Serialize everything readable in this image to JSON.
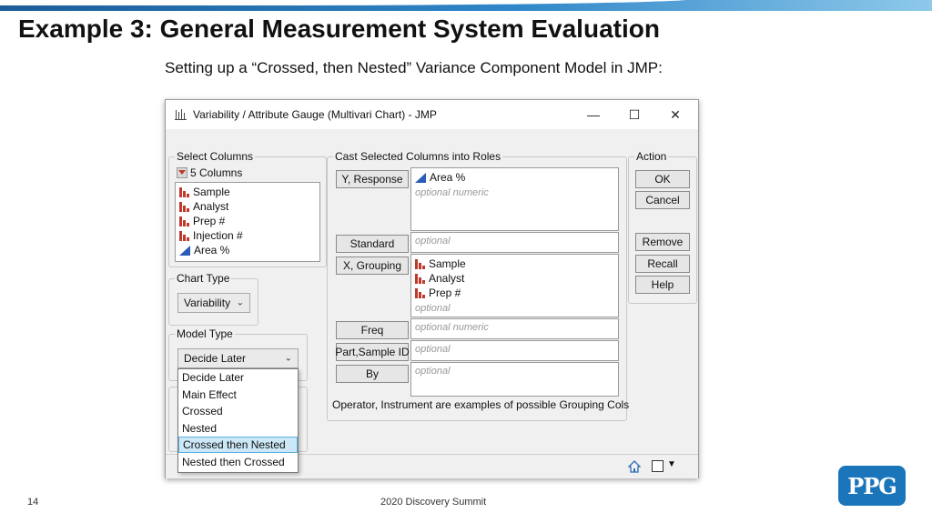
{
  "slide": {
    "title": "Example 3: General Measurement System Evaluation",
    "subtitle": "Setting up a “Crossed, then Nested” Variance Component Model in JMP:",
    "page_number": "14",
    "event": "2020 Discovery Summit",
    "logo_text": "PPG",
    "brand_color": "#1b75bb"
  },
  "window": {
    "title": "Variability / Attribute Gauge (Multivari Chart) - JMP",
    "minimize_glyph": "—",
    "maximize_glyph": "☐",
    "close_glyph": "✕"
  },
  "select_columns": {
    "label": "Select Columns",
    "count_label": "5 Columns",
    "items": [
      {
        "label": "Sample",
        "icon": "nominal-bar-icon"
      },
      {
        "label": "Analyst",
        "icon": "nominal-bar-icon"
      },
      {
        "label": "Prep #",
        "icon": "nominal-bar-icon"
      },
      {
        "label": "Injection #",
        "icon": "nominal-bar-icon"
      },
      {
        "label": "Area %",
        "icon": "continuous-triangle-icon"
      }
    ]
  },
  "chart_type": {
    "label": "Chart Type",
    "value": "Variability"
  },
  "model_type": {
    "label": "Model Type",
    "value": "Decide Later",
    "options": [
      "Decide Later",
      "Main Effect",
      "Crossed",
      "Nested",
      "Crossed then Nested",
      "Nested then Crossed"
    ],
    "selected": "Crossed then Nested"
  },
  "roles": {
    "label": "Cast Selected Columns into Roles",
    "y_response": {
      "button": "Y, Response",
      "item": "Area %",
      "placeholder": "optional numeric"
    },
    "standard": {
      "button": "Standard",
      "placeholder": "optional"
    },
    "x_grouping": {
      "button": "X, Grouping",
      "items": [
        "Sample",
        "Analyst",
        "Prep #"
      ],
      "placeholder": "optional"
    },
    "freq": {
      "button": "Freq",
      "placeholder": "optional numeric"
    },
    "part_sample_id": {
      "button": "Part,Sample ID",
      "placeholder": "optional"
    },
    "by": {
      "button": "By",
      "placeholder": "optional"
    },
    "note": "Operator, Instrument are examples of possible Grouping Cols"
  },
  "action": {
    "label": "Action",
    "ok": "OK",
    "cancel": "Cancel",
    "remove": "Remove",
    "recall": "Recall",
    "help": "Help"
  },
  "statusbar": {
    "dropdown_glyph": "▼"
  }
}
